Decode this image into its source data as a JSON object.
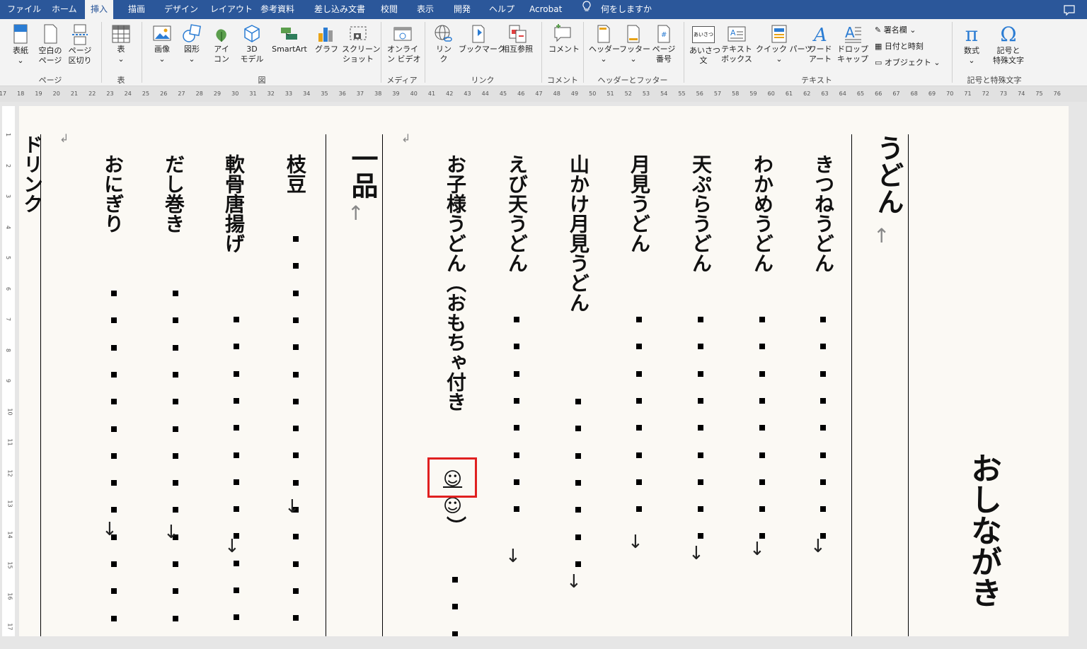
{
  "tabs": [
    "ファイル",
    "ホーム",
    "挿入",
    "描画",
    "デザイン",
    "レイアウト",
    "参考資料",
    "差し込み文書",
    "校閲",
    "表示",
    "開発",
    "ヘルプ",
    "Acrobat"
  ],
  "active_tab": "挿入",
  "tell_me": "何をしますか",
  "ribbon": {
    "pages_group": {
      "label": "ページ",
      "cover": "表紙",
      "blank1": "空白の",
      "blank2": "ページ",
      "break1": "ページ",
      "break2": "区切り"
    },
    "table_group": {
      "label": "表",
      "table": "表"
    },
    "illust_group": {
      "label": "図",
      "picture": "画像",
      "shapes": "図形",
      "icons1": "アイ",
      "icons2": "コン",
      "model1": "3D",
      "model2": "モデル",
      "smartart": "SmartArt",
      "chart": "グラフ",
      "shot1": "スクリーン",
      "shot2": "ショット"
    },
    "media_group": {
      "label": "メディア",
      "video1": "オンライ",
      "video2": "ン ビデオ"
    },
    "links_group": {
      "label": "リンク",
      "link1": "リン",
      "link2": "ク",
      "bookmark": "ブックマーク",
      "crossref": "相互参照"
    },
    "comment_group": {
      "label": "コメント",
      "comment": "コメント"
    },
    "hf_group": {
      "label": "ヘッダーとフッター",
      "header": "ヘッダー",
      "footer": "フッター",
      "pnum1": "ページ",
      "pnum2": "番号"
    },
    "text_group": {
      "label": "テキスト",
      "greet1": "あいさつ",
      "greet2": "文",
      "textbox1": "テキスト",
      "textbox2": "ボックス",
      "quickparts": "クイック パーツ",
      "wordart1": "ワード",
      "wordart2": "アート",
      "dropcap1": "ドロップ",
      "dropcap2": "キャップ",
      "signature": "署名欄",
      "datetime": "日付と時刻",
      "object": "オブジェクト",
      "greet_icon": "あいさつ"
    },
    "symbol_group": {
      "label": "記号と特殊文字",
      "equation": "数式",
      "symbol1": "記号と",
      "symbol2": "特殊文字",
      "pi": "π",
      "omega": "Ω"
    }
  },
  "ruler_numbers": [
    "17",
    "18",
    "19",
    "20",
    "21",
    "22",
    "23",
    "24",
    "25",
    "26",
    "27",
    "28",
    "29",
    "30",
    "31",
    "32",
    "33",
    "34",
    "35",
    "36",
    "37",
    "38",
    "39",
    "40",
    "41",
    "42",
    "43",
    "44",
    "45",
    "46",
    "47",
    "48",
    "49",
    "50",
    "51",
    "52",
    "53",
    "54",
    "55",
    "56",
    "57",
    "58",
    "59",
    "60",
    "61",
    "62",
    "63",
    "64",
    "65",
    "66",
    "67",
    "68",
    "69",
    "70",
    "71",
    "72",
    "73",
    "74",
    "75",
    "76"
  ],
  "vruler_numbers": [
    "1",
    "2",
    "3",
    "4",
    "5",
    "6",
    "7",
    "8",
    "9",
    "10",
    "11",
    "12",
    "13",
    "14",
    "15",
    "16",
    "17"
  ],
  "document": {
    "title": "おしながき",
    "udon_header": "うどん",
    "udon_items": [
      "きつねうどん",
      "わかめうどん",
      "天ぷらうどん",
      "月見うどん",
      "山かけ月見うどん",
      "えび天うどん"
    ],
    "kids_item": "お子様うどん（おもちゃ付き",
    "smiley_selected": "☺",
    "smiley_second": "☺",
    "close_paren": "）",
    "ippin_header": "一品",
    "ippin_items": [
      "枝豆",
      "軟骨唐揚げ",
      "だし巻き",
      "おにぎり"
    ],
    "partial_left": "ドリンク",
    "arrow": "↓",
    "return_mark": "↑",
    "small_mark": "↲"
  }
}
